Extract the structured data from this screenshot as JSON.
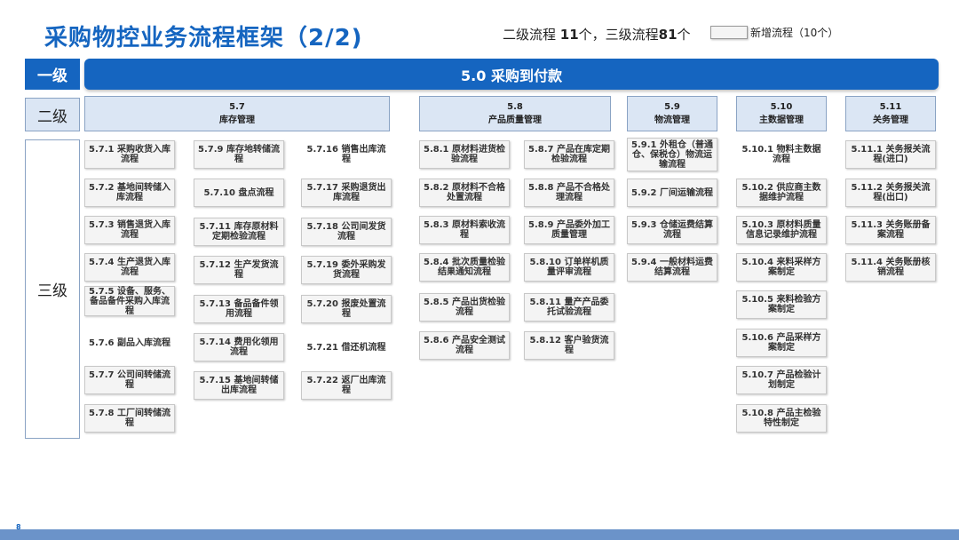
{
  "title": "采购物控业务流程框架（2/2)",
  "summary": {
    "part1": "二级流程 ",
    "count_l2": "11",
    "part2": "个，三级流程",
    "count_l3": "81",
    "part3": "个"
  },
  "legend": {
    "label": "新增流程（10个）"
  },
  "levels": {
    "l1": "一级",
    "l2": "二级",
    "l3": "三级"
  },
  "l1_banner": "5.0 采购到付款",
  "l2": {
    "c57": {
      "code": "5.7",
      "name": "库存管理"
    },
    "c58": {
      "code": "5.8",
      "name": "产品质量管理"
    },
    "c59": {
      "code": "5.9",
      "name": "物流管理"
    },
    "c510": {
      "code": "5.10",
      "name": "主数据管理"
    },
    "c511": {
      "code": "5.11",
      "name": "关务管理"
    }
  },
  "p": {
    "571": "5.7.1 采购收货入库流程",
    "572": "5.7.2 基地间转储入库流程",
    "573": "5.7.3 销售退货入库流程",
    "574": "5.7.4 生产退货入库流程",
    "575": "5.7.5 设备、服务、备品备件采购入库流程",
    "576": "5.7.6 副品入库流程",
    "577": "5.7.7 公司间转储流程",
    "578": "5.7.8 工厂间转储流程",
    "579": "5.7.9 库存地转储流程",
    "5710": "5.7.10 盘点流程",
    "5711": "5.7.11 库存原材料定期检验流程",
    "5712": "5.7.12 生产发货流程",
    "5713": "5.7.13 备品备件领用流程",
    "5714": "5.7.14 费用化领用流程",
    "5715": "5.7.15 基地间转储出库流程",
    "5716": "5.7.16 销售出库流程",
    "5717": "5.7.17 采购退货出库流程",
    "5718": "5.7.18 公司间发货流程",
    "5719": "5.7.19 委外采购发货流程",
    "5720": "5.7.20 报废处置流程",
    "5721": "5.7.21 借还机流程",
    "5722": "5.7.22 返厂出库流程",
    "581": "5.8.1 原材料进货检验流程",
    "582": "5.8.2 原材料不合格处置流程",
    "583": "5.8.3 原材料索收流程",
    "584": "5.8.4 批次质量检验结果通知流程",
    "585": "5.8.5 产品出货检验流程",
    "586": "5.8.6 产品安全测试流程",
    "587": "5.8.7 产品在库定期检验流程",
    "588": "5.8.8 产品不合格处理流程",
    "589": "5.8.9 产品委外加工质量管理",
    "5810": "5.8.10 订单样机质量评审流程",
    "5811": "5.8.11 量产产品委托试验流程",
    "5812": "5.8.12 客户验货流程",
    "591": "5.9.1 外租仓（普通仓、保税仓）物流运输流程",
    "592": "5.9.2 厂间运输流程",
    "593": "5.9.3 仓储运费结算流程",
    "594": "5.9.4 一般材料运费结算流程",
    "5101": "5.10.1 物料主数据流程",
    "5102": "5.10.2 供应商主数据维护流程",
    "5103": "5.10.3 原材料质量信息记录维护流程",
    "5104": "5.10.4 来料采样方案制定",
    "5105": "5.10.5 来料检验方案制定",
    "5106": "5.10.6 产品采样方案制定",
    "5107": "5.10.7 产品检验计划制定",
    "5108": "5.10.8 产品主检验特性制定",
    "5111": "5.11.1 关务报关流程(进口)",
    "5112": "5.11.2 关务报关流程(出口)",
    "5113": "5.11.3 关务账册备案流程",
    "5114": "5.11.4 关务账册核销流程"
  },
  "page_number": "8",
  "colors": {
    "brand": "#1565C0",
    "l2_fill": "#dbe6f4",
    "footer": "#6b93c9"
  }
}
